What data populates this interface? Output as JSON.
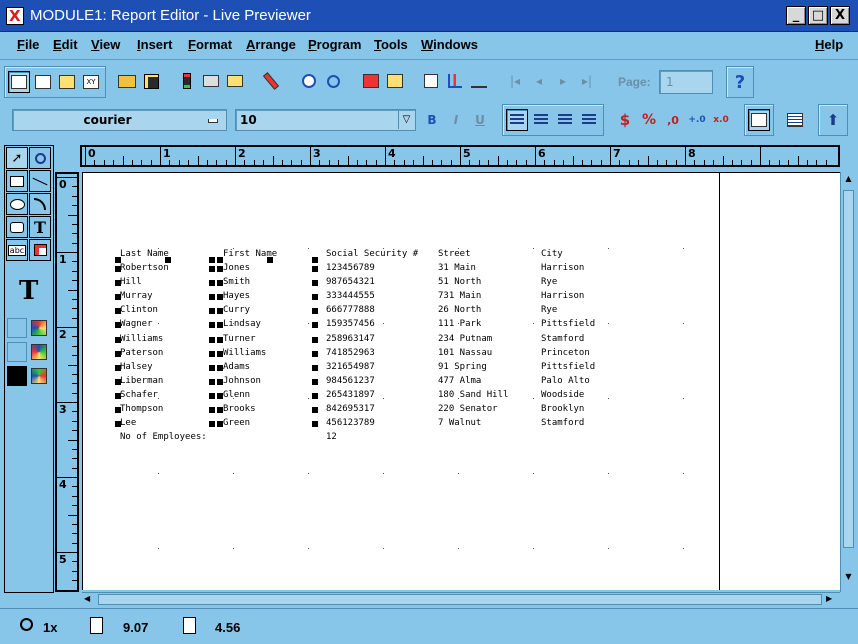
{
  "window": {
    "title": "MODULE1: Report Editor - Live Previewer",
    "minimize": "_",
    "maximize": "□",
    "close": "X"
  },
  "menu": {
    "file": "File",
    "edit": "Edit",
    "view": "View",
    "insert": "Insert",
    "format": "Format",
    "arrange": "Arrange",
    "program": "Program",
    "tools": "Tools",
    "windows": "Windows",
    "help": "Help"
  },
  "toolbar": {
    "page_label": "Page:",
    "page_value": "1",
    "help_glyph": "?"
  },
  "format_bar": {
    "font": "courier",
    "size": "10",
    "bold": "B",
    "italic": "I",
    "underline": "U",
    "percent": "%",
    "commas": ",0",
    "add_decimal": "+.0",
    "remove_decimal": "x.0"
  },
  "palette": {
    "text_tool_glyph": "T",
    "abc_label": "abc",
    "big_text_glyph": "T"
  },
  "ruler": {
    "h_labels": [
      "0",
      "1",
      "2",
      "3",
      "4",
      "5",
      "6",
      "7",
      "8"
    ],
    "v_labels": [
      "0",
      "1",
      "2",
      "3",
      "4",
      "5"
    ]
  },
  "report": {
    "headers": {
      "last_name": "Last Name",
      "first_name": "First Name",
      "ssn": "Social Security #",
      "street": "Street",
      "city": "City"
    },
    "rows": [
      {
        "last": "Robertson",
        "first": "Jones",
        "ssn": "123456789",
        "street": "31 Main",
        "city": "Harrison"
      },
      {
        "last": "Hill",
        "first": "Smith",
        "ssn": "987654321",
        "street": "51 North",
        "city": "Rye"
      },
      {
        "last": "Murray",
        "first": "Hayes",
        "ssn": "333444555",
        "street": "731 Main",
        "city": "Harrison"
      },
      {
        "last": "Clinton",
        "first": "Curry",
        "ssn": "666777888",
        "street": "26 North",
        "city": "Rye"
      },
      {
        "last": "Wagner",
        "first": "Lindsay",
        "ssn": "159357456",
        "street": "111 Park",
        "city": "Pittsfield"
      },
      {
        "last": "Williams",
        "first": "Turner",
        "ssn": "258963147",
        "street": "234 Putnam",
        "city": "Stamford"
      },
      {
        "last": "Paterson",
        "first": "Williams",
        "ssn": "741852963",
        "street": "101 Nassau",
        "city": "Princeton"
      },
      {
        "last": "Halsey",
        "first": "Adams",
        "ssn": "321654987",
        "street": "91 Spring",
        "city": "Pittsfield"
      },
      {
        "last": "Liberman",
        "first": "Johnson",
        "ssn": "984561237",
        "street": "477 Alma",
        "city": "Palo Alto"
      },
      {
        "last": "Schafer",
        "first": "Glenn",
        "ssn": "265431897",
        "street": "180 Sand Hill",
        "city": "Woodside"
      },
      {
        "last": "Thompson",
        "first": "Brooks",
        "ssn": "842695317",
        "street": "220 Senator",
        "city": "Brooklyn"
      },
      {
        "last": "Lee",
        "first": "Green",
        "ssn": "456123789",
        "street": "7 Walnut",
        "city": "Stamford"
      }
    ],
    "summary_label": "No of Employees:",
    "summary_value": "12"
  },
  "status": {
    "zoom": "1x",
    "x_pos": "9.07",
    "y_pos": "4.56"
  },
  "colors": {
    "window_bg": "#87c6e8",
    "title_bar": "#1e4fb4",
    "canvas": "#ffffff"
  }
}
